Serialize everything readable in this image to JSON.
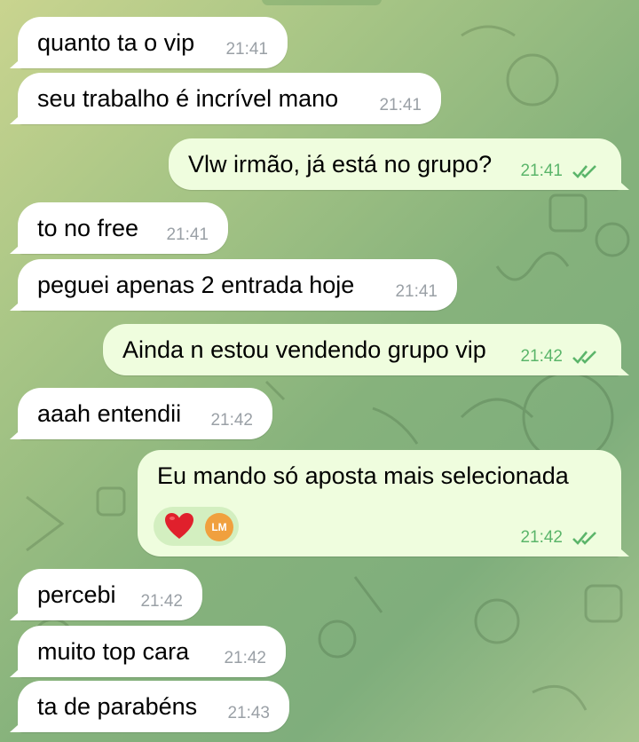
{
  "messages": [
    {
      "text": "quanto ta o vip",
      "time": "21:41"
    },
    {
      "text": "seu trabalho é incrível mano",
      "time": "21:41"
    },
    {
      "text": "Vlw irmão, já está no grupo?",
      "time": "21:41"
    },
    {
      "text": "to no free",
      "time": "21:41"
    },
    {
      "text": "peguei apenas 2 entrada hoje",
      "time": "21:41"
    },
    {
      "text": "Ainda n estou vendendo grupo vip",
      "time": "21:42"
    },
    {
      "text": "aaah entendii",
      "time": "21:42"
    },
    {
      "text": "Eu mando só aposta mais selecionada",
      "time": "21:42",
      "reactions": [
        "heart-emoji",
        "avatar-initials"
      ],
      "reaction_avatar": "LM"
    },
    {
      "text": "percebi",
      "time": "21:42"
    },
    {
      "text": "muito top cara",
      "time": "21:42"
    },
    {
      "text": "ta de parabéns",
      "time": "21:43"
    }
  ],
  "colors": {
    "incoming_bubble": "#ffffff",
    "outgoing_bubble": "#effdde",
    "outgoing_time": "#5bb56a",
    "incoming_time": "#9aa0a6",
    "heart": "#e0202c",
    "avatar": "#f0a03e"
  },
  "icons": [
    "double-check-icon",
    "heart-emoji",
    "avatar"
  ]
}
